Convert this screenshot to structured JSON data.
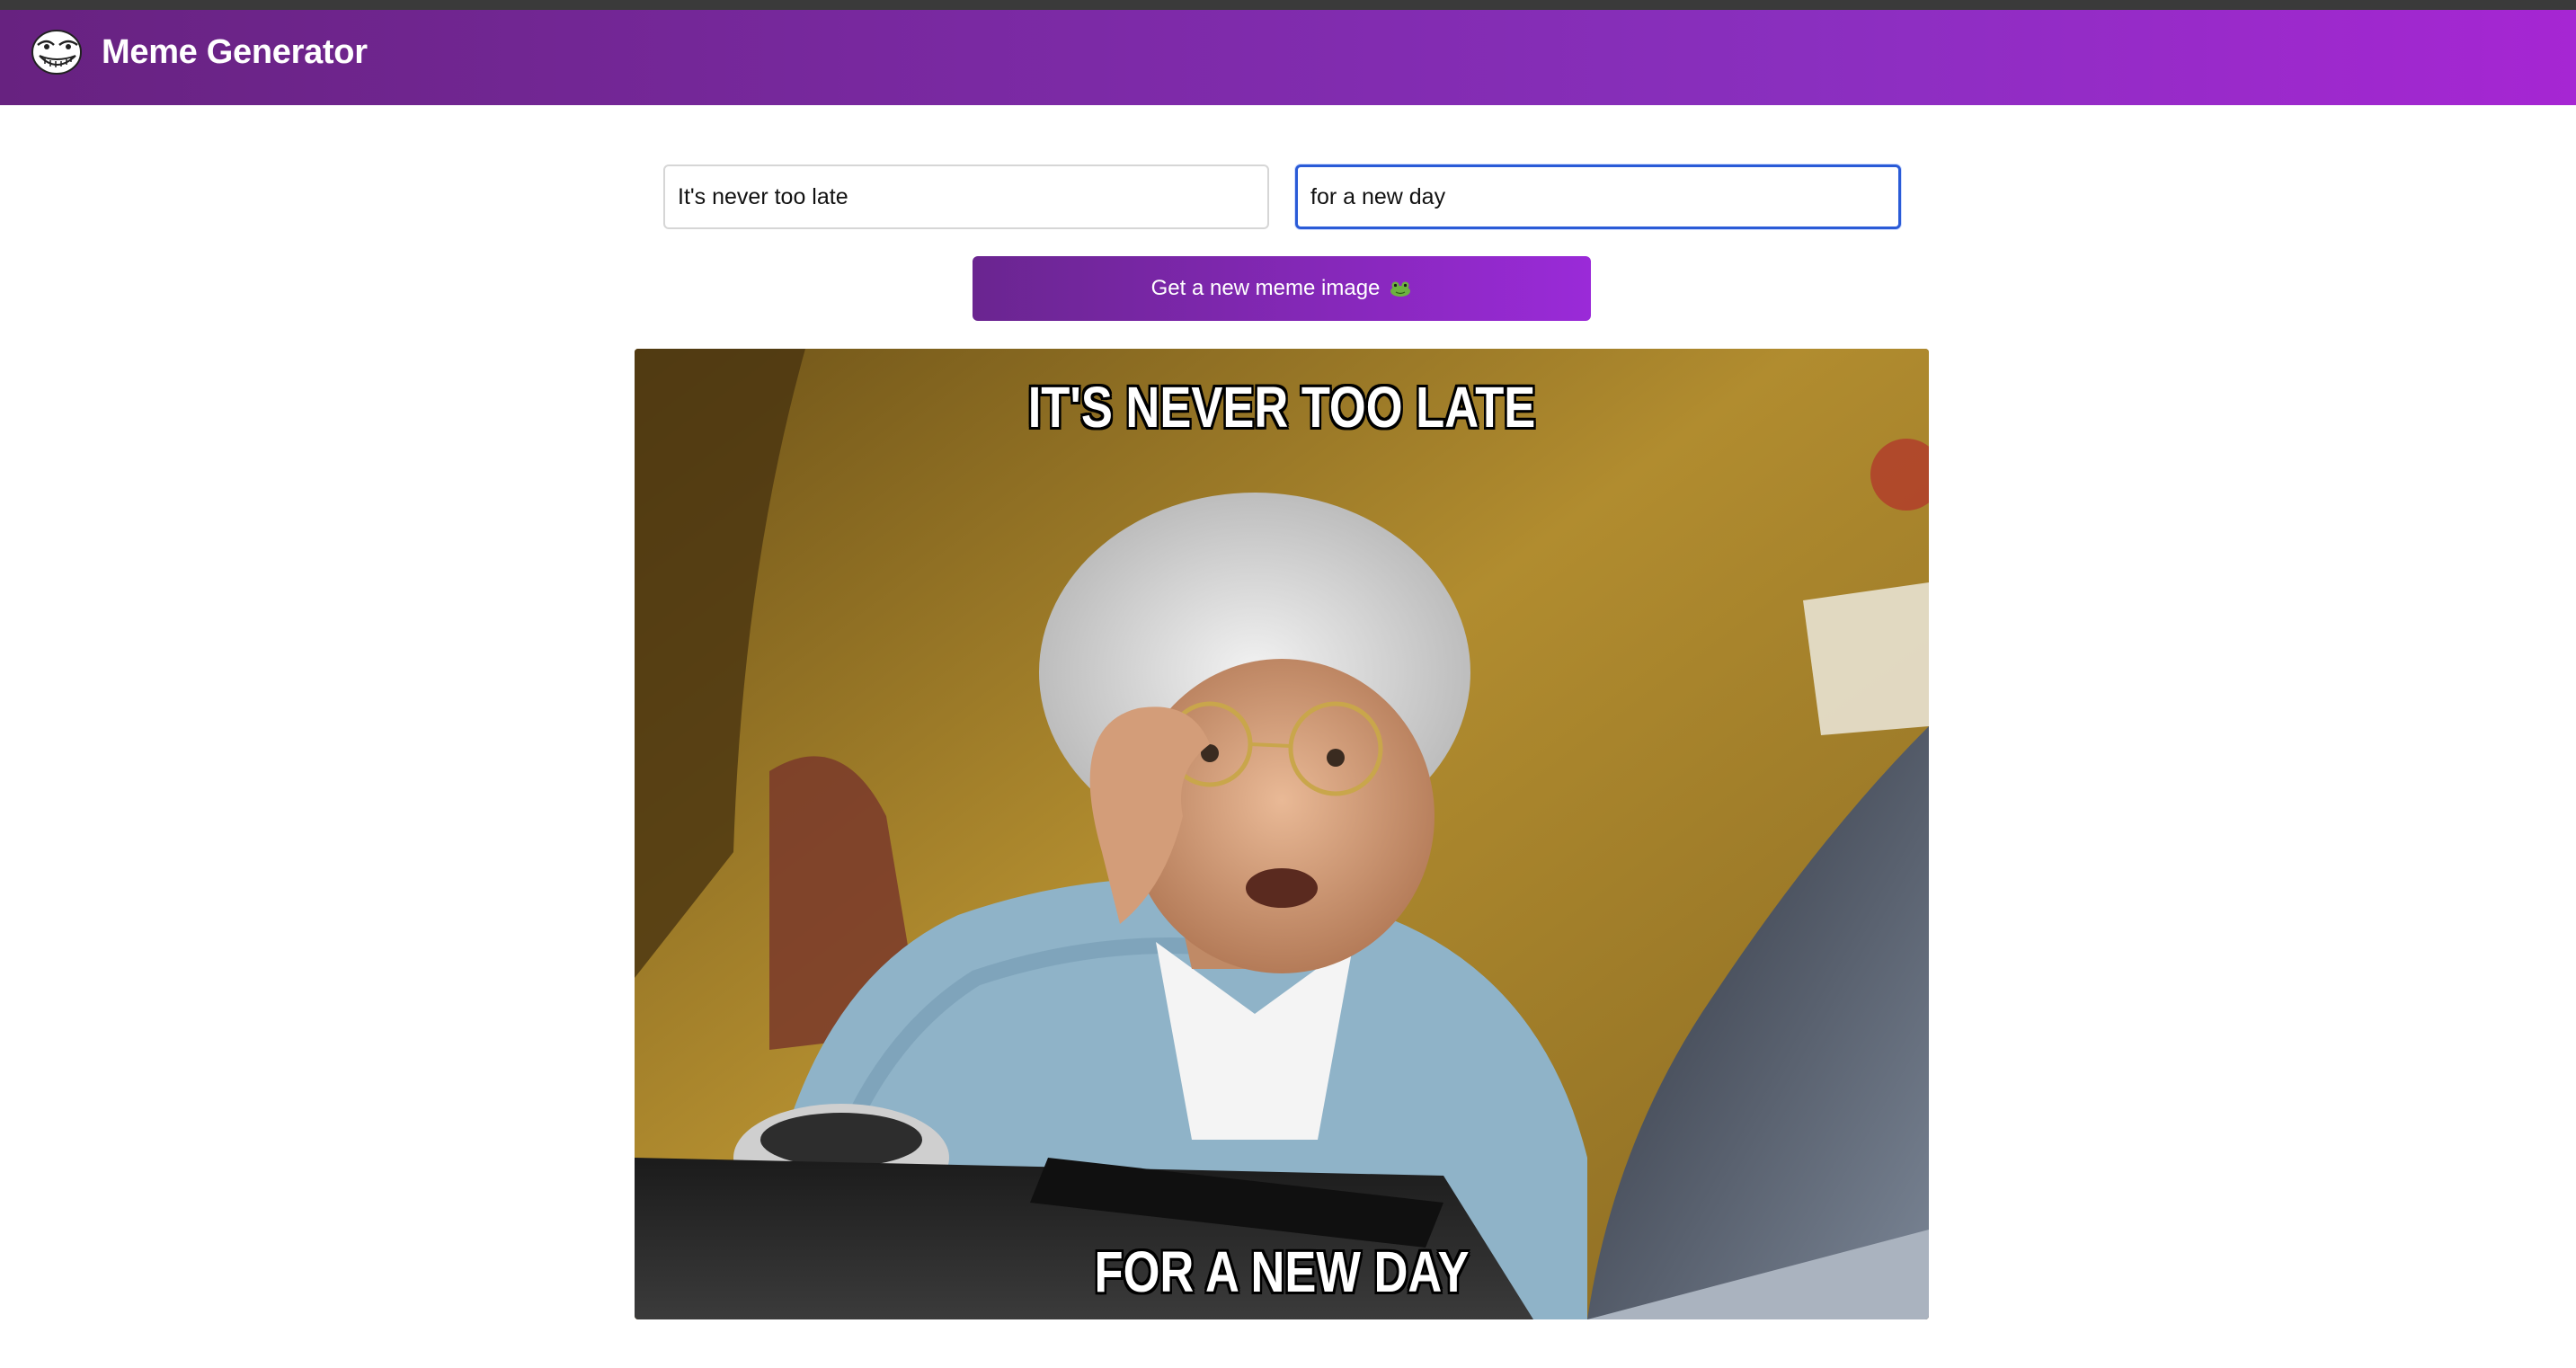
{
  "header": {
    "title": "Meme Generator",
    "logo_icon": "trollface-icon",
    "gradient_start": "#672280",
    "gradient_end": "#a626d3"
  },
  "form": {
    "top_text_value": "It's never too late",
    "bottom_text_value": "for a new day",
    "button_label": "Get a new meme image",
    "button_icon": "frog-emoji-icon"
  },
  "meme": {
    "top_caption": "It's never too late",
    "bottom_caption": "for a new day",
    "image_subject": "grandma-at-computer"
  }
}
